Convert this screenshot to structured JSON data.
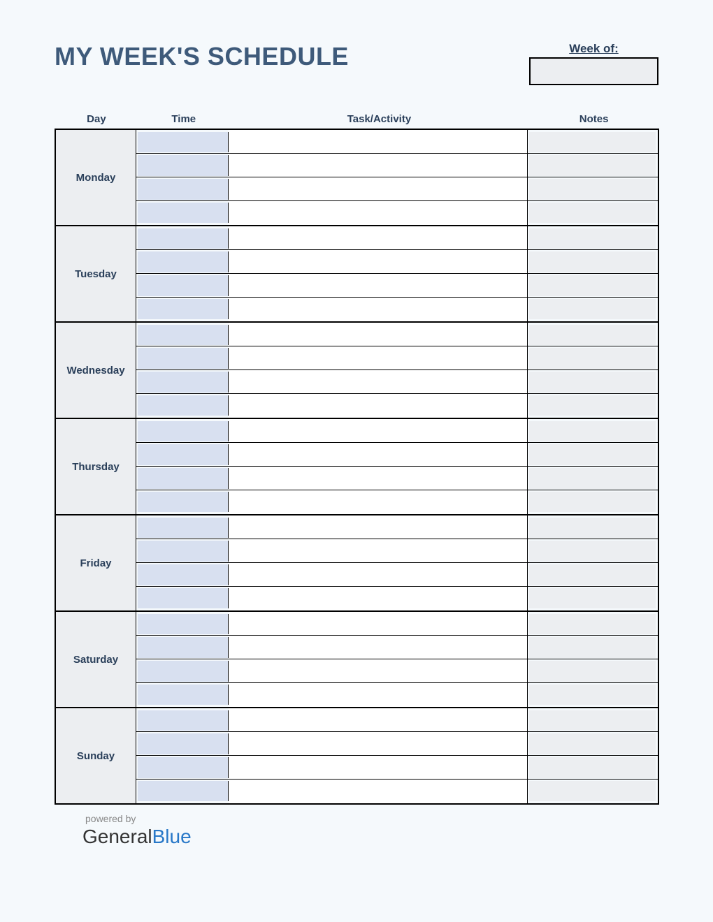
{
  "title": "MY WEEK'S SCHEDULE",
  "week_of_label": "Week of:",
  "columns": {
    "day": "Day",
    "time": "Time",
    "task": "Task/Activity",
    "notes": "Notes"
  },
  "days": [
    "Monday",
    "Tuesday",
    "Wednesday",
    "Thursday",
    "Friday",
    "Saturday",
    "Sunday"
  ],
  "rows_per_day": 4,
  "footer": {
    "powered_by": "powered by",
    "logo_part1": "General",
    "logo_part2": "Blue"
  }
}
